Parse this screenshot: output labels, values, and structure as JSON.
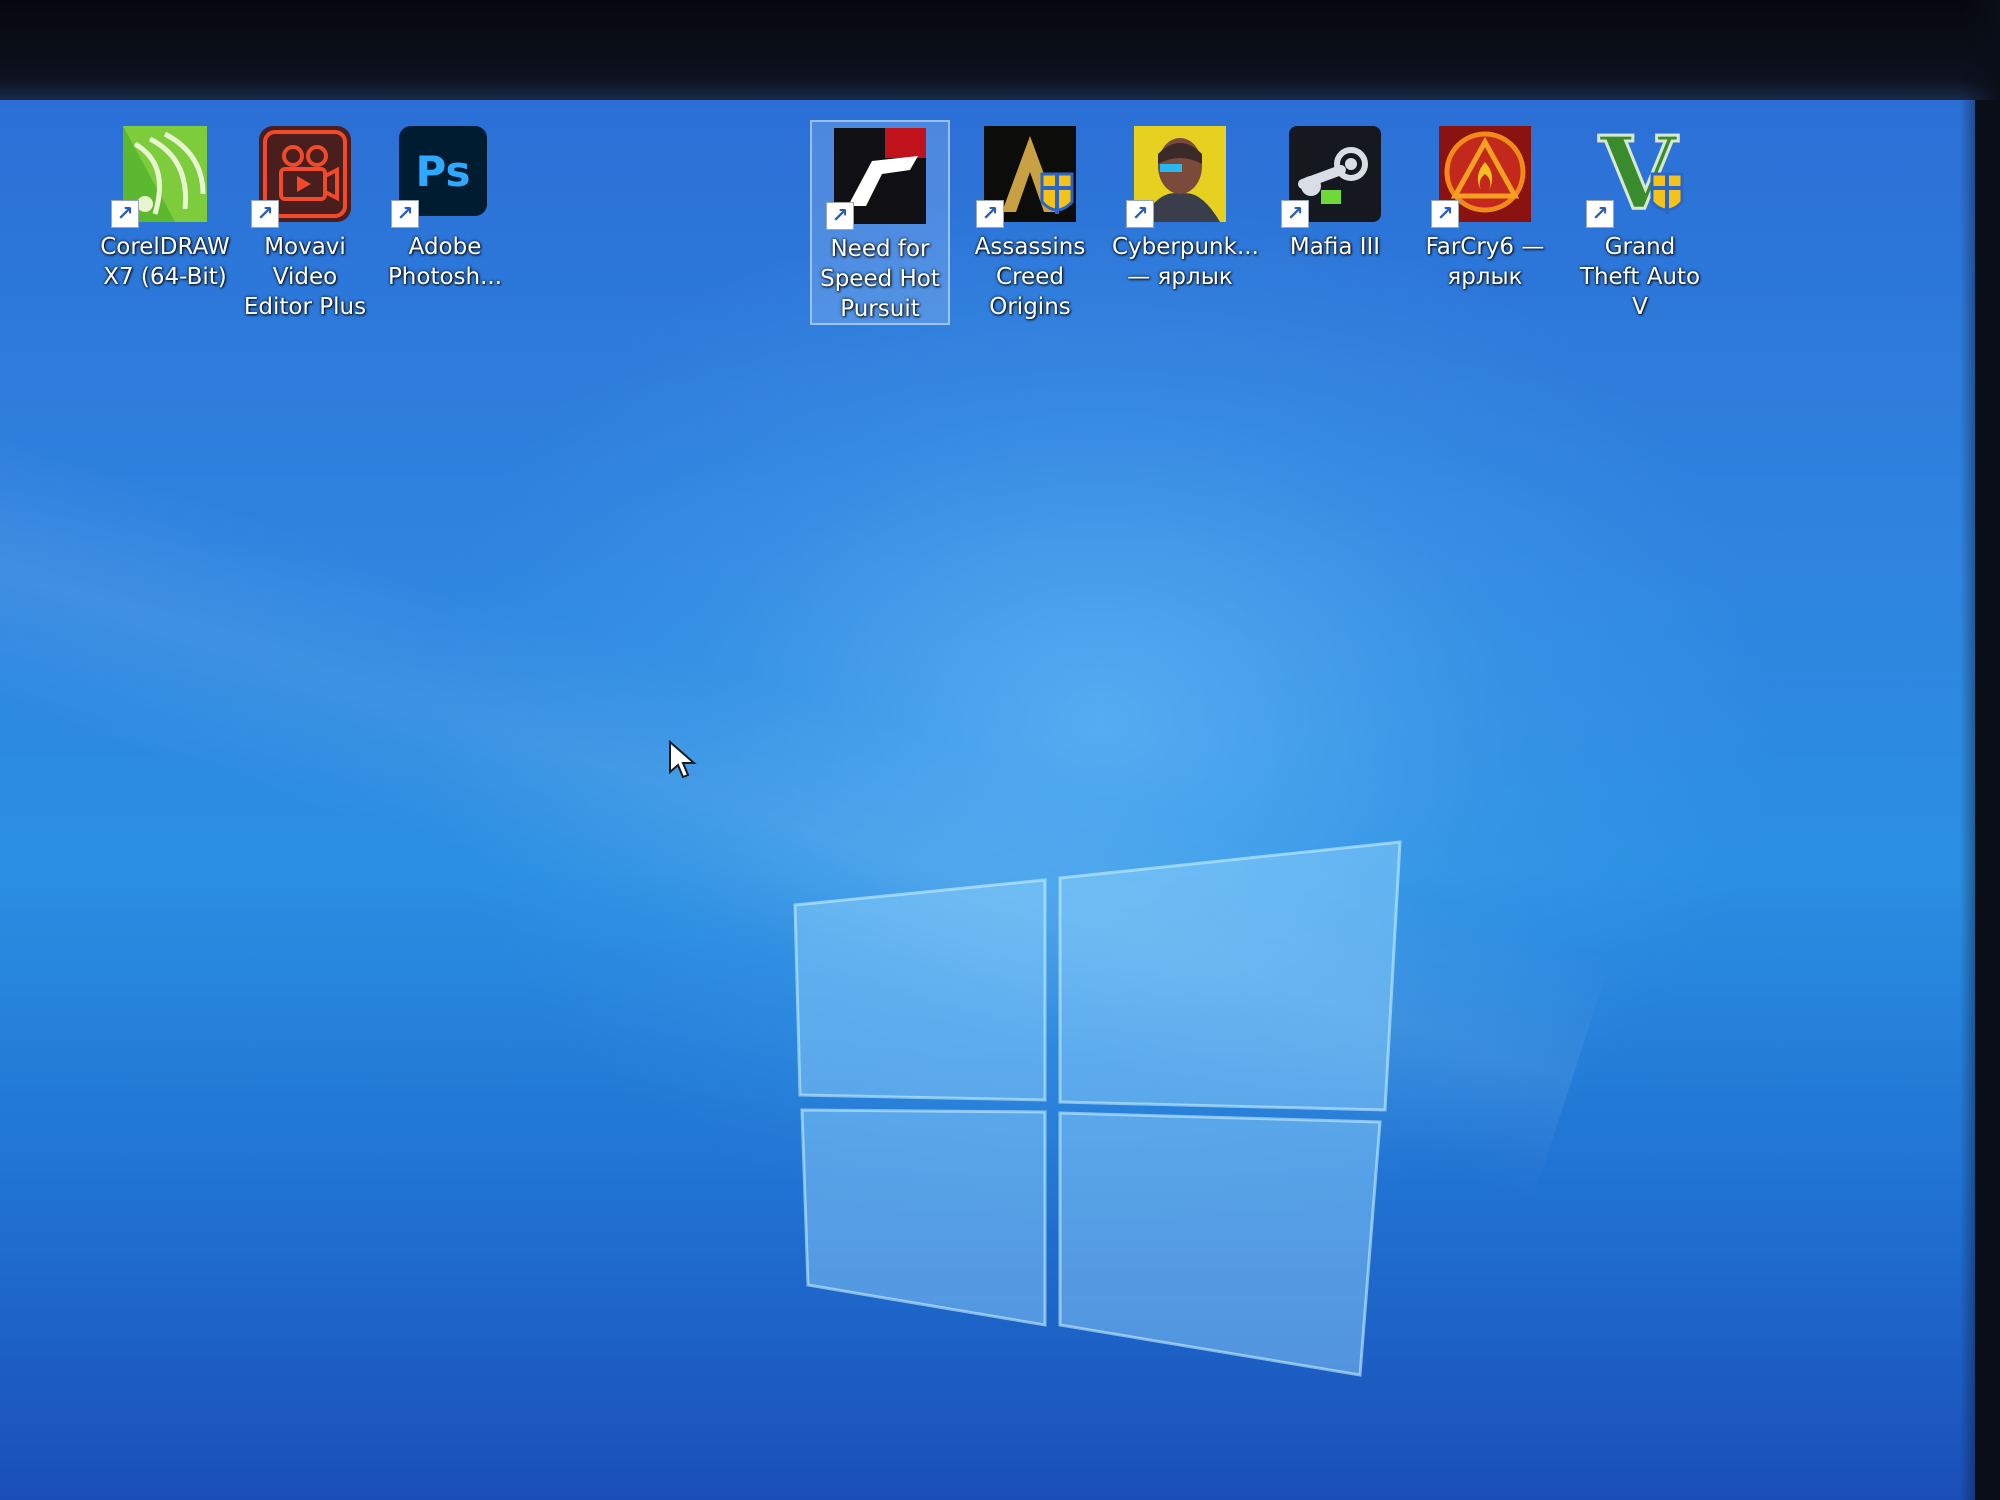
{
  "desktop": {
    "icons": [
      {
        "label": "CorelDRAW X7 (64-Bit)",
        "icon": "coreldraw-icon",
        "shortcut": true
      },
      {
        "label": "Movavi Video Editor Plus",
        "icon": "movavi-icon",
        "shortcut": true
      },
      {
        "label": "Adobe Photosh...",
        "icon": "photoshop-icon",
        "shortcut": true,
        "glyph": "Ps"
      },
      {
        "label": "Need for Speed Hot Pursuit",
        "icon": "nfs-icon",
        "shortcut": true,
        "selected": true
      },
      {
        "label": "Assassins Creed Origins",
        "icon": "assassins-creed-icon",
        "shortcut": true
      },
      {
        "label": "Cyberpunk... — ярлык",
        "icon": "cyberpunk-icon",
        "shortcut": true
      },
      {
        "label": "Mafia III",
        "icon": "steam-icon",
        "shortcut": true
      },
      {
        "label": "FarCry6 — ярлык",
        "icon": "farcry-icon",
        "shortcut": true
      },
      {
        "label": "Grand Theft Auto V",
        "icon": "gta-v-icon",
        "shortcut": true,
        "glyph": "V"
      }
    ],
    "wallpaper": "windows-10-hero-blue",
    "colors": {
      "wallpaper_top": "#2b6fd6",
      "wallpaper_mid": "#2a8fe2",
      "wallpaper_bottom": "#1a4fb8"
    }
  },
  "shortcut_glyph": "↗"
}
